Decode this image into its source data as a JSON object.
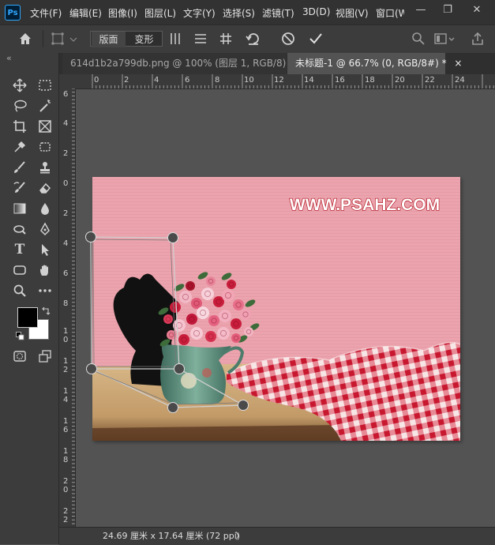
{
  "app": {
    "logo": "Ps"
  },
  "menu": [
    "文件(F)",
    "编辑(E)",
    "图像(I)",
    "图层(L)",
    "文字(Y)",
    "选择(S)",
    "滤镜(T)",
    "3D(D)",
    "视图(V)",
    "窗口(W"
  ],
  "window_controls": {
    "minimize": "—",
    "restore": "❐",
    "close": "✕"
  },
  "options_bar": {
    "home_icon": "home-icon",
    "layout_label": "版面",
    "transform_label": "变形",
    "collapse_icon": "«"
  },
  "tabs": [
    {
      "label": "614d1b2a799db.png @ 100% (图层 1, RGB/8) *",
      "close": "×",
      "active": false
    },
    {
      "label": "未标题-1 @ 66.7% (0, RGB/8#) *",
      "close": "×",
      "active": true
    }
  ],
  "ruler_top": [
    "0",
    "2",
    "4",
    "6",
    "8",
    "10",
    "12",
    "14",
    "16",
    "18",
    "20",
    "22",
    "24"
  ],
  "ruler_left": [
    "6",
    "4",
    "2",
    "0",
    "2",
    "4",
    "6",
    "8",
    "1\n0",
    "1\n2",
    "1\n4",
    "1\n6",
    "1\n8",
    "2\n0",
    "2\n2"
  ],
  "document": {
    "watermark": "WWW.PSAHZ.COM",
    "colors": {
      "background": "#eba3ad",
      "table": "#c9a06a",
      "checker_red": "#d8233c",
      "vase": "#5d8e7c"
    }
  },
  "status": {
    "size_text": "24.69 厘米 x 17.64 厘米 (72 ppi)",
    "arrow": "〉"
  },
  "colors": {
    "foreground": "#000000",
    "background": "#ffffff"
  }
}
